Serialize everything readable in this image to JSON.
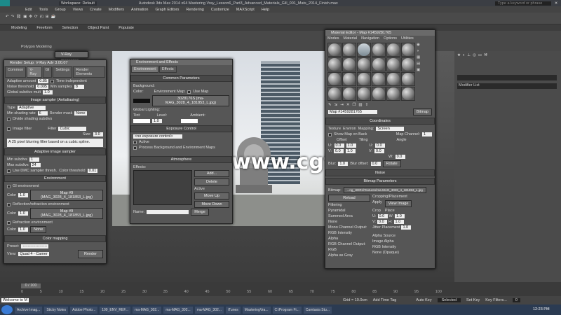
{
  "app": {
    "title": "Autodesk 3ds Max 2014 x64     Mastering Vray_Lesson6_Part3_Advanced_Materials_Gill_001_Mats_2014_Finish.max",
    "workspace": "Workspace: Default",
    "search_placeholder": "Type a keyword or phrase"
  },
  "menu": [
    "Edit",
    "Tools",
    "Group",
    "Views",
    "Create",
    "Modifiers",
    "Animation",
    "Graph Editors",
    "Rendering",
    "Customize",
    "MAXScript",
    "Help"
  ],
  "ribbon_tabs": [
    "Modeling",
    "Freeform",
    "Selection",
    "Object Paint",
    "Populate"
  ],
  "ribbon_sub": "Polygon Modeling",
  "vray_messages": "V-Ray messages",
  "watermark": "www.cgtsj.com",
  "render_setup": {
    "title": "Render Setup: V-Ray Adv 3.00.07",
    "tabs": [
      "Common",
      "V-Ray",
      "GI",
      "Settings",
      "Render Elements"
    ],
    "adaptive_amount_label": "Adaptive amount",
    "adaptive_amount": "0.85",
    "noise_threshold_label": "Noise threshold",
    "noise_threshold": "0.005",
    "global_subdivs_label": "Global subdivs mult",
    "global_subdivs": "1.0",
    "time_independent": "Time independent",
    "min_samples_label": "Min samples",
    "min_samples": "8",
    "image_sampler_section": "Image sampler (Antialiasing)",
    "type_label": "Type",
    "type_value": "Adaptive",
    "min_shading_label": "Min shading rate",
    "min_shading": "6",
    "render_mask_label": "Render mask",
    "render_mask": "None",
    "divide_shading": "Divide shading subdivs",
    "image_filter": "Image filter",
    "filter_label": "Filter",
    "filter_value": "Cubic",
    "size_label": "Size:",
    "size_value": "3.0",
    "filter_desc": "A 25 pixel blurring filter based on a cubic spline.",
    "adaptive_section": "Adaptive image sampler",
    "min_subdivs_label": "Min subdivs",
    "min_subdivs": "1",
    "max_subdivs_label": "Max subdivs",
    "max_subdivs": "24",
    "use_dmc": "Use DMC sampler thresh.",
    "color_threshold_label": "Color threshold",
    "color_threshold": "0.01",
    "environment_section": "Environment",
    "gi_environment": "GI environment",
    "color_label": "Color",
    "mult_1": "1.0",
    "map_1": "Map #9 (MAG_3028_4_181853_L.jpg)",
    "reflection_env": "Reflection/refraction environment",
    "mult_2": "1.0",
    "map_2": "Map #9 (MAG_3028_4_181853_L.jpg)",
    "refraction_env": "Refraction environment",
    "mult_3": "1.0",
    "map_3": "None",
    "color_mapping_section": "Color mapping",
    "preset_label": "Preset:",
    "preset_value": "-------------------",
    "view_label": "View:",
    "view_value": "Quad 4 - Camer",
    "render_button": "Render"
  },
  "env_effects": {
    "title": "Environment and Effects",
    "tabs": [
      "Environment",
      "Effects"
    ],
    "common_params": "Common Parameters",
    "background_label": "Background:",
    "color_label": "Color:",
    "env_map_label": "Environment Map:",
    "use_map": "Use Map",
    "env_map_value": "3028176S (ma-MAG_3028_4_181853_L.jpg)",
    "global_lighting": "Global Lighting:",
    "tint_label": "Tint:",
    "level_label": "Level:",
    "level_value": "1.0",
    "ambient_label": "Ambient:",
    "exposure_section": "Exposure Control",
    "exposure_value": "<no exposure control>",
    "active": "Active",
    "process_bg": "Process Background and Environment Maps",
    "atmosphere_section": "Atmosphere",
    "effects_label": "Effects:",
    "add": "Add...",
    "delete": "Delete",
    "active2": "Active",
    "move_up": "Move Up",
    "move_down": "Move Down",
    "name_label": "Name:",
    "merge": "Merge"
  },
  "material_editor": {
    "title": "Material Editor - Map #1459281765",
    "menu": [
      "Modes",
      "Material",
      "Navigation",
      "Options",
      "Utilities"
    ],
    "map_name": "Map #1459281765",
    "map_type": "Bitmap",
    "coordinates_section": "Coordinates",
    "texture": "Texture",
    "environ": "Environ",
    "mapping_label": "Mapping:",
    "mapping_value": "Screen",
    "show_map_on_back": "Show Map on Back",
    "map_channel_label": "Map Channel:",
    "map_channel": "1",
    "offset_label": "Offset",
    "tiling_label": "Tiling",
    "angle_label": "Angle",
    "u_offset": "0.0",
    "v_offset": "0.0",
    "u_tiling": "1.0",
    "v_tiling": "1.0",
    "u_angle": "0.0",
    "v_angle": "0.0",
    "w_angle": "0.0",
    "blur_label": "Blur:",
    "blur": "1.0",
    "blur_offset_label": "Blur offset:",
    "blur_offset": "0.0",
    "rotate": "Rotate",
    "noise_section": "Noise",
    "bitmap_params_section": "Bitmap Parameters",
    "bitmap_label": "Bitmap:",
    "bitmap_value": "...ng_HDRs\\Textures\\ma-MAG_3028_4_181853_L.jpg",
    "reload": "Reload",
    "cropping_label": "Cropping/Placement",
    "apply": "Apply",
    "view_image": "View Image",
    "crop": "Crop",
    "place": "Place",
    "u_label": "U:",
    "w_label": "W:",
    "v_label": "V:",
    "h_label": "H:",
    "crop_u": "0.0",
    "crop_w": "1.0",
    "crop_v": "0.0",
    "crop_h": "1.0",
    "jitter_label": "Jitter Placement",
    "jitter": "1.0",
    "filtering_label": "Filtering",
    "pyramidal": "Pyramidal",
    "summed_area": "Summed Area",
    "none": "None",
    "mono_output_label": "Mono Channel Output:",
    "rgb_intensity": "RGB Intensity",
    "alpha": "Alpha",
    "rgb_output_label": "RGB Channel Output:",
    "rgb": "RGB",
    "alpha_as_gray": "Alpha as Gray",
    "alpha_source_label": "Alpha Source",
    "image_alpha": "Image Alpha",
    "rgb_intensity2": "RGB Intensity",
    "none_opaque": "None (Opaque)"
  },
  "command_panel": {
    "modifier_list": "Modifier List"
  },
  "timeline": {
    "frame": "0 / 100",
    "ticks": [
      "0",
      "5",
      "10",
      "15",
      "20",
      "25",
      "30",
      "35",
      "40",
      "45",
      "50",
      "55",
      "60",
      "65",
      "70",
      "75",
      "80",
      "85",
      "90",
      "95",
      "100"
    ]
  },
  "status": {
    "welcome": "Welcome to M",
    "grid": "Grid = 10.0cm",
    "auto_key": "Auto Key",
    "selected": "Selected",
    "set_key": "Set Key",
    "key_filters": "Key Filters...",
    "add_time_tag": "Add Time Tag",
    "frame_value": "0"
  },
  "taskbar": {
    "items": [
      "Archive Imag...",
      "Sticky Notes",
      "Adobe Photo...",
      "109_ENV_REF...",
      "ma-MAG_302...",
      "ma-MAG_302...",
      "ma-MAG_302...",
      "iTunes",
      "MasteringVra...",
      "C:\\Program Fi...",
      "Camtasia Stu..."
    ],
    "clock": "12:23 PM"
  }
}
